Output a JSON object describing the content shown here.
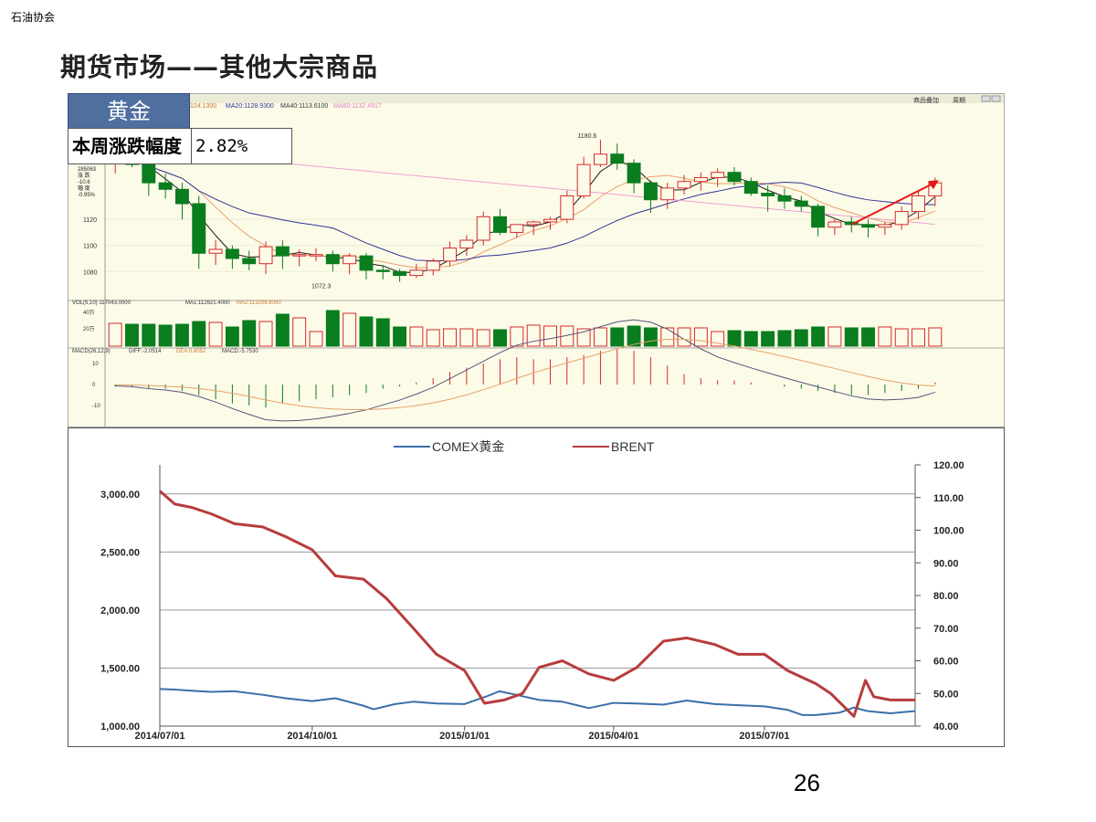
{
  "header": {
    "org": "石油协会",
    "title": "期货市场——其他大宗商品"
  },
  "badge": {
    "name": "黄金",
    "label": "本周涨跌幅度",
    "value": "2.82%"
  },
  "page_number": "26",
  "kpanel": {
    "ma_line": {
      "tail_prefix": "124.1300",
      "ma20": "MA20:1128.9300",
      "ma40": "MA40:1113.6100",
      "ma60": "MA60:1132.4917"
    },
    "buttons": [
      "商品叠加",
      "周期"
    ],
    "left_info": [
      "285063",
      "涨 跌",
      "-10.6",
      "幅 度",
      "-0.95%"
    ],
    "price_axis": [
      "1120",
      "1100",
      "1080"
    ],
    "high_label": "1180.6",
    "low_label": "1072.3",
    "vol_line": {
      "vol": "VOL(5,10) 117043.0000",
      "ma1": "MA1:112621.4000",
      "ma2": "MA2:113209.8000"
    },
    "vol_axis": [
      "40万",
      "20万"
    ],
    "macd_line": {
      "macd": "MACD(26,12,9)",
      "diff": "DIFF:-2.0514",
      "dea": "DEA:0.8052",
      "hist": "MACD:-5.7530"
    },
    "macd_axis": [
      "10",
      "0",
      "-10"
    ],
    "candles": [
      [
        1165,
        1178,
        1155,
        1172
      ],
      [
        1172,
        1182,
        1160,
        1162
      ],
      [
        1162,
        1170,
        1138,
        1148
      ],
      [
        1148,
        1155,
        1136,
        1143
      ],
      [
        1143,
        1148,
        1120,
        1132
      ],
      [
        1132,
        1138,
        1082,
        1094
      ],
      [
        1094,
        1104,
        1085,
        1097
      ],
      [
        1097,
        1100,
        1082,
        1090
      ],
      [
        1090,
        1096,
        1081,
        1086
      ],
      [
        1086,
        1103,
        1078,
        1099
      ],
      [
        1099,
        1104,
        1082,
        1092
      ],
      [
        1092,
        1097,
        1084,
        1093
      ],
      [
        1093,
        1098,
        1088,
        1093
      ],
      [
        1093,
        1096,
        1080,
        1086
      ],
      [
        1086,
        1094,
        1078,
        1092
      ],
      [
        1092,
        1094,
        1074,
        1081
      ],
      [
        1081,
        1085,
        1074,
        1080
      ],
      [
        1080,
        1082,
        1072,
        1077
      ],
      [
        1077,
        1086,
        1075,
        1081
      ],
      [
        1081,
        1090,
        1077,
        1088
      ],
      [
        1088,
        1103,
        1084,
        1098
      ],
      [
        1098,
        1108,
        1092,
        1104
      ],
      [
        1104,
        1126,
        1100,
        1122
      ],
      [
        1122,
        1128,
        1108,
        1110
      ],
      [
        1110,
        1116,
        1106,
        1116
      ],
      [
        1116,
        1119,
        1108,
        1118
      ],
      [
        1118,
        1122,
        1112,
        1120
      ],
      [
        1120,
        1142,
        1117,
        1138
      ],
      [
        1138,
        1168,
        1136,
        1162
      ],
      [
        1162,
        1181,
        1160,
        1170
      ],
      [
        1170,
        1178,
        1158,
        1163
      ],
      [
        1163,
        1166,
        1140,
        1148
      ],
      [
        1148,
        1150,
        1125,
        1135
      ],
      [
        1135,
        1148,
        1128,
        1144
      ],
      [
        1144,
        1154,
        1139,
        1149
      ],
      [
        1149,
        1156,
        1142,
        1152
      ],
      [
        1152,
        1159,
        1145,
        1156
      ],
      [
        1156,
        1160,
        1146,
        1149
      ],
      [
        1149,
        1152,
        1138,
        1140
      ],
      [
        1140,
        1146,
        1126,
        1138
      ],
      [
        1138,
        1144,
        1128,
        1134
      ],
      [
        1134,
        1138,
        1126,
        1130
      ],
      [
        1130,
        1132,
        1107,
        1114
      ],
      [
        1114,
        1120,
        1108,
        1118
      ],
      [
        1118,
        1122,
        1110,
        1116
      ],
      [
        1116,
        1120,
        1106,
        1114
      ],
      [
        1114,
        1118,
        1108,
        1116
      ],
      [
        1116,
        1130,
        1112,
        1126
      ],
      [
        1126,
        1142,
        1120,
        1138
      ],
      [
        1138,
        1152,
        1130,
        1148
      ]
    ],
    "volumes": [
      25,
      24,
      24,
      23,
      24,
      27,
      26,
      21,
      28,
      27,
      35,
      31,
      16,
      39,
      36,
      32,
      30,
      21,
      21,
      18,
      19,
      19,
      18,
      18,
      21,
      23,
      22,
      22,
      19,
      20,
      20,
      22,
      20,
      20,
      20,
      20,
      16,
      17,
      16,
      16,
      17,
      18,
      21,
      21,
      20,
      20,
      21,
      19,
      19,
      20
    ],
    "macd_hist": [
      -1,
      -1,
      -2,
      -2,
      -3,
      -5,
      -7,
      -9,
      -10,
      -11,
      -9,
      -8,
      -7,
      -6,
      -5,
      -4,
      -2,
      -1,
      1,
      3,
      6,
      8,
      10,
      12,
      13,
      12,
      12,
      13,
      14,
      16,
      17,
      16,
      13,
      9,
      5,
      3,
      2,
      2,
      1,
      0,
      -1,
      -2,
      -3,
      -4,
      -5,
      -5,
      -4,
      -3,
      -2,
      1
    ],
    "colors": {
      "up": "#d42a2a",
      "down": "#0a7d1e",
      "ma5": "#1a1a1a",
      "ma10": "#e8a068",
      "ma20": "#333399",
      "ma60": "#f0a0d0",
      "arrow": "#e01818"
    }
  },
  "chart_data": {
    "type": "line",
    "title": "",
    "xlabel": "",
    "ylabel": "",
    "y2label": "",
    "x_ticks": [
      "2014/07/01",
      "2014/10/01",
      "2015/01/01",
      "2015/04/01",
      "2015/07/01"
    ],
    "x_range": [
      "2014/07/01",
      "2015/09/30"
    ],
    "ylim": [
      1000,
      3250
    ],
    "y_ticks": [
      "1,000.00",
      "1,500.00",
      "2,000.00",
      "2,500.00",
      "3,000.00"
    ],
    "y2lim": [
      40,
      120
    ],
    "y2_ticks": [
      "40.00",
      "50.00",
      "60.00",
      "70.00",
      "80.00",
      "90.00",
      "100.00",
      "110.00",
      "120.00"
    ],
    "legend_position": "top",
    "grid": true,
    "series": [
      {
        "name": "COMEX黄金",
        "axis": "left",
        "color": "#3a6fa8",
        "x": [
          "2014/07/01",
          "2014/07/10",
          "2014/07/20",
          "2014/08/01",
          "2014/08/15",
          "2014/09/01",
          "2014/09/15",
          "2014/10/01",
          "2014/10/15",
          "2014/11/01",
          "2014/11/07",
          "2014/11/20",
          "2014/12/01",
          "2014/12/15",
          "2015/01/01",
          "2015/01/15",
          "2015/01/22",
          "2015/02/01",
          "2015/02/15",
          "2015/03/01",
          "2015/03/17",
          "2015/04/01",
          "2015/04/15",
          "2015/05/01",
          "2015/05/15",
          "2015/06/01",
          "2015/06/15",
          "2015/07/01",
          "2015/07/15",
          "2015/07/24",
          "2015/08/01",
          "2015/08/15",
          "2015/08/24",
          "2015/09/01",
          "2015/09/15",
          "2015/09/30"
        ],
        "y": [
          1320,
          1315,
          1305,
          1295,
          1300,
          1270,
          1240,
          1215,
          1240,
          1175,
          1145,
          1190,
          1210,
          1195,
          1190,
          1260,
          1300,
          1270,
          1225,
          1210,
          1155,
          1200,
          1195,
          1185,
          1220,
          1190,
          1180,
          1170,
          1140,
          1095,
          1095,
          1115,
          1160,
          1130,
          1110,
          1130
        ]
      },
      {
        "name": "BRENT",
        "axis": "right",
        "color": "#b83c3c",
        "x": [
          "2014/07/01",
          "2014/07/10",
          "2014/07/20",
          "2014/08/01",
          "2014/08/15",
          "2014/09/01",
          "2014/09/15",
          "2014/10/01",
          "2014/10/15",
          "2014/11/01",
          "2014/11/15",
          "2014/12/01",
          "2014/12/15",
          "2015/01/01",
          "2015/01/13",
          "2015/01/25",
          "2015/02/05",
          "2015/02/15",
          "2015/03/01",
          "2015/03/17",
          "2015/04/01",
          "2015/04/15",
          "2015/05/01",
          "2015/05/15",
          "2015/06/01",
          "2015/06/15",
          "2015/07/01",
          "2015/07/15",
          "2015/08/01",
          "2015/08/10",
          "2015/08/24",
          "2015/08/31",
          "2015/09/05",
          "2015/09/15",
          "2015/09/30"
        ],
        "y": [
          112,
          108,
          107,
          105,
          102,
          101,
          98,
          94,
          86,
          85,
          79,
          70,
          62,
          57,
          47,
          48,
          50,
          58,
          60,
          56,
          54,
          58,
          66,
          67,
          65,
          62,
          62,
          57,
          53,
          50,
          43,
          54,
          49,
          48,
          48
        ]
      }
    ]
  }
}
